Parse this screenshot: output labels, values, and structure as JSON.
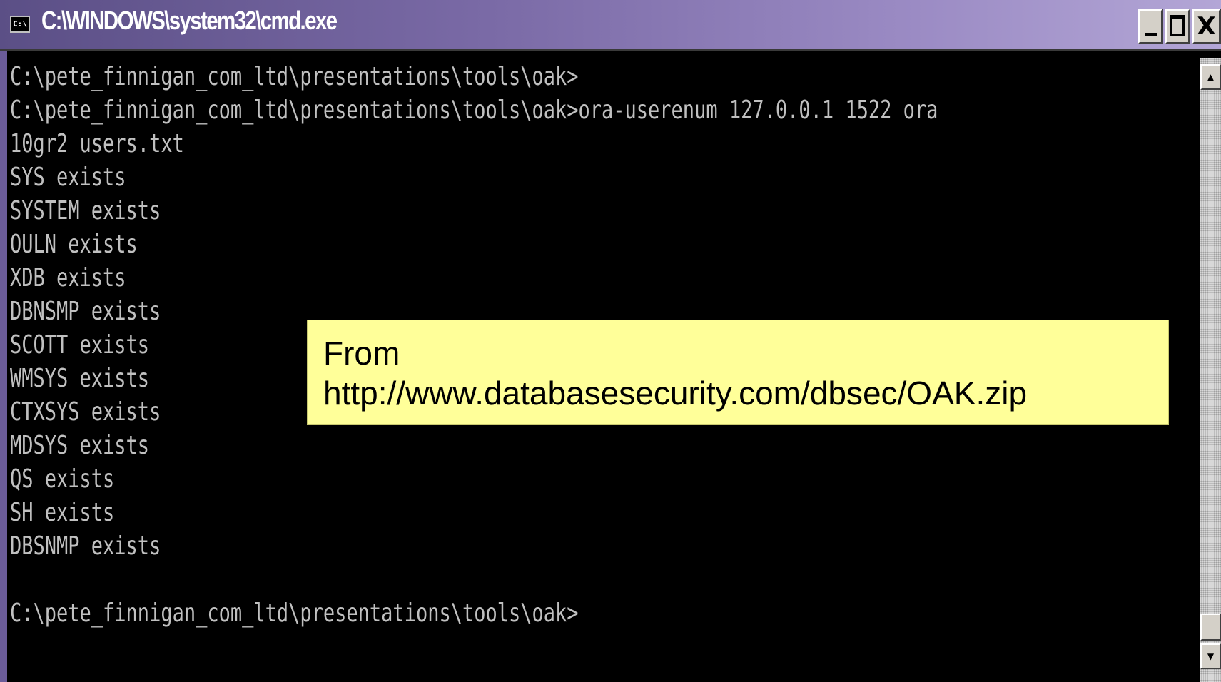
{
  "window": {
    "title": "C:\\WINDOWS\\system32\\cmd.exe",
    "icon": "cmd-prompt-icon",
    "icon_text": "C:\\",
    "controls": {
      "minimize": "minimize-icon",
      "maximize": "maximize-icon",
      "close_label": "X"
    }
  },
  "console": {
    "lines": [
      "C:\\pete_finnigan_com_ltd\\presentations\\tools\\oak>",
      "C:\\pete_finnigan_com_ltd\\presentations\\tools\\oak>ora-userenum 127.0.0.1 1522 ora",
      "10gr2 users.txt",
      "SYS exists",
      "SYSTEM exists",
      "OULN exists",
      "XDB exists",
      "DBNSMP exists",
      "SCOTT exists",
      "WMSYS exists",
      "CTXSYS exists",
      "MDSYS exists",
      "QS exists",
      "SH exists",
      "DBSNMP exists",
      "",
      "C:\\pete_finnigan_com_ltd\\presentations\\tools\\oak>"
    ]
  },
  "callout": {
    "line1": "From",
    "line2": "http://www.databasesecurity.com/dbsec/OAK.zip"
  },
  "scrollbar": {
    "up": "scroll-up-icon",
    "down": "scroll-down-icon"
  },
  "colors": {
    "title_bar": "#7a6aa6",
    "console_bg": "#000000",
    "console_text": "#c0c0c0",
    "callout_bg": "#ffff99"
  }
}
